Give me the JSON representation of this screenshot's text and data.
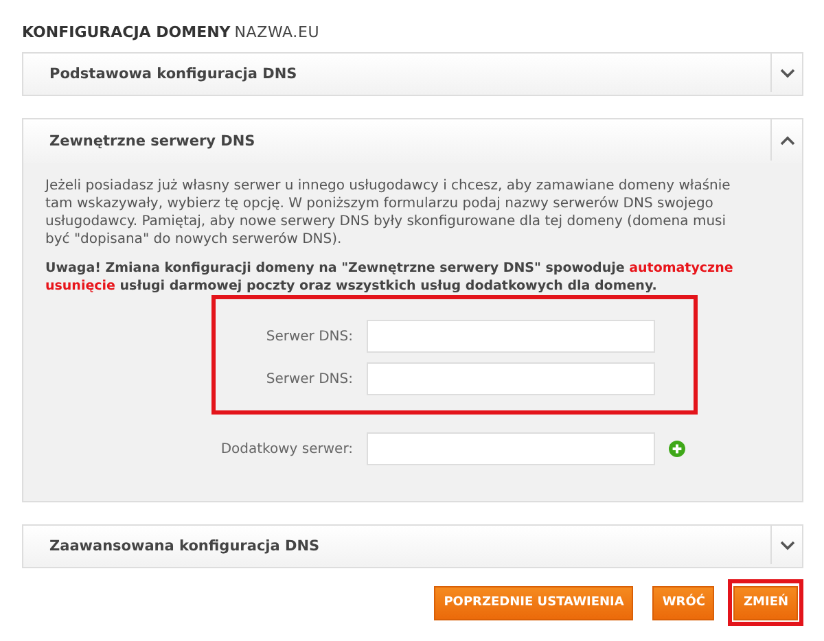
{
  "heading": {
    "title": "KONFIGURACJA DOMENY",
    "domain": "NAZWA.EU"
  },
  "sections": [
    {
      "title": "Podstawowa konfiguracja DNS",
      "expanded": false
    },
    {
      "title": "Zewnętrzne serwery DNS",
      "expanded": true,
      "description": "Jeżeli posiadasz już własny serwer u innego usługodawcy i chcesz, aby zamawiane domeny właśnie tam wskazywały, wybierz tę opcję. W poniższym formularzu podaj nazwy serwerów DNS swojego usługodawcy. Pamiętaj, aby nowe serwery DNS były skonfigurowane dla tej domeny (domena musi być \"dopisana\" do nowych serwerów DNS).",
      "warning": [
        {
          "text": "Uwaga! Zmiana konfiguracji domeny na \"Zewnętrzne serwery DNS\" spowoduje ",
          "emphasis": false
        },
        {
          "text": "automatyczne usunięcie",
          "emphasis": true
        },
        {
          "text": " usługi darmowej poczty oraz wszystkich usług dodatkowych dla domeny.",
          "emphasis": false
        }
      ],
      "field_groups": [
        {
          "highlighted": true,
          "fields": [
            {
              "label": "Serwer DNS:",
              "addable": false
            },
            {
              "label": "Serwer DNS:",
              "addable": false
            }
          ]
        },
        {
          "highlighted": false,
          "fields": [
            {
              "label": "Dodatkowy serwer:",
              "addable": true
            }
          ]
        }
      ]
    },
    {
      "title": "Zaawansowana konfiguracja DNS",
      "expanded": false
    }
  ],
  "buttons": [
    {
      "label": "POPRZEDNIE USTAWIENIA",
      "highlighted": false
    },
    {
      "label": "WRÓĆ",
      "highlighted": false
    },
    {
      "label": "ZMIEŃ",
      "highlighted": true
    }
  ]
}
